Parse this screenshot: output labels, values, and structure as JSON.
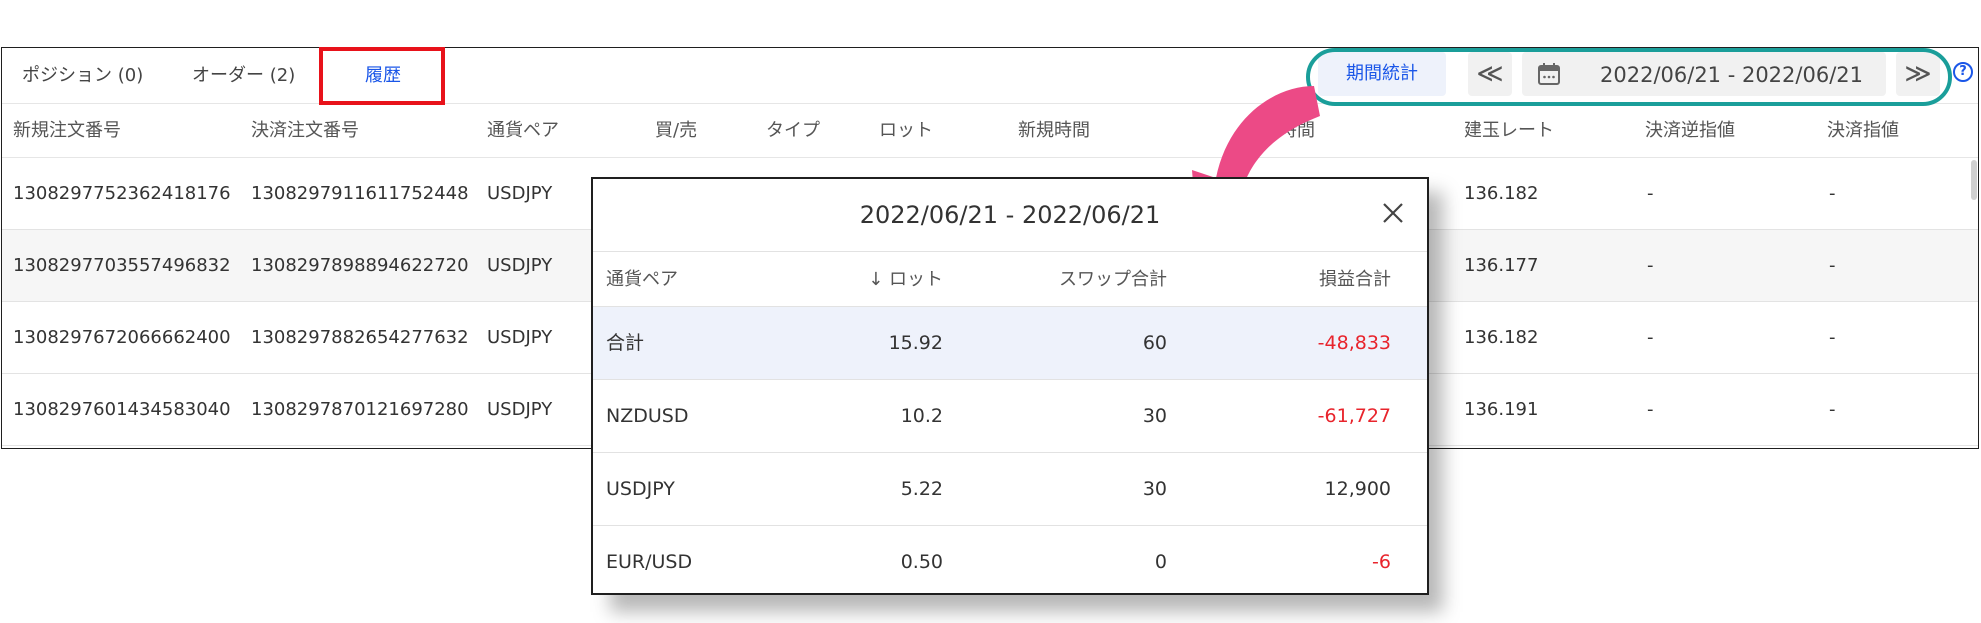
{
  "tabs": [
    {
      "label": "ポジション (0)"
    },
    {
      "label": "オーダー (2)"
    },
    {
      "label": "履歴"
    }
  ],
  "toolbar": {
    "stats_label": "期間統計",
    "prev_label": "≪",
    "next_label": "≫",
    "date_range": "2022/06/21 - 2022/06/21",
    "help_label": "?"
  },
  "table": {
    "headers": [
      "新規注文番号",
      "決済注文番号",
      "通貨ペア",
      "買/売",
      "タイプ",
      "ロット",
      "新規時間",
      "時間",
      "建玉レート",
      "決済逆指値",
      "決済指値"
    ],
    "rows": [
      [
        "1308297752362418176",
        "1308297911611752448",
        "USDJPY",
        "136.182",
        "-",
        "-"
      ],
      [
        "1308297703557496832",
        "1308297898894622720",
        "USDJPY",
        "136.177",
        "-",
        "-"
      ],
      [
        "1308297672066662400",
        "1308297882654277632",
        "USDJPY",
        "136.182",
        "-",
        "-"
      ],
      [
        "1308297601434583040",
        "1308297870121697280",
        "USDJPY",
        "136.191",
        "-",
        "-"
      ]
    ]
  },
  "popup": {
    "title": "2022/06/21 - 2022/06/21",
    "headers": {
      "pair": "通貨ペア",
      "lot": "↓ ロット",
      "swap": "スワップ合計",
      "pnl": "損益合計"
    },
    "rows": [
      {
        "pair": "合計",
        "lot": "15.92",
        "swap": "60",
        "pnl": "-48,833"
      },
      {
        "pair": "NZDUSD",
        "lot": "10.2",
        "swap": "30",
        "pnl": "-61,727"
      },
      {
        "pair": "USDJPY",
        "lot": "5.22",
        "swap": "30",
        "pnl": "12,900"
      },
      {
        "pair": "EUR/USD",
        "lot": "0.50",
        "swap": "0",
        "pnl": "-6"
      }
    ]
  },
  "colors": {
    "accent": "#1a56e8",
    "negative": "#e8242c",
    "highlight_red": "#e8121a",
    "highlight_teal": "#1a9e9a",
    "annotation_arrow": "#ec4a86"
  }
}
